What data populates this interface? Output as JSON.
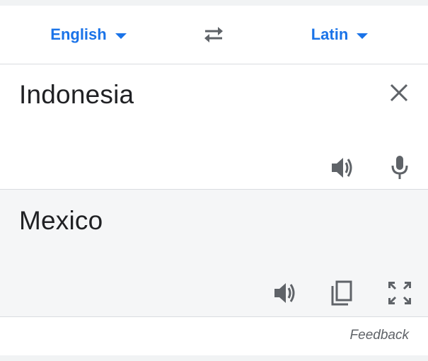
{
  "language_bar": {
    "source_language": "English",
    "target_language": "Latin"
  },
  "source": {
    "text": "Indonesia"
  },
  "target": {
    "text": "Mexico"
  },
  "footer": {
    "feedback_label": "Feedback"
  },
  "icons": {
    "swap": "swap-arrows-icon",
    "clear": "close-icon",
    "source_listen": "speaker-icon",
    "mic": "microphone-icon",
    "target_listen": "speaker-icon",
    "copy": "copy-icon",
    "fullscreen": "fullscreen-icon"
  },
  "colors": {
    "accent": "#1a73e8",
    "icon": "#5f6368",
    "text": "#202124",
    "target_background": "#f5f6f7",
    "divider": "#dadce0"
  }
}
